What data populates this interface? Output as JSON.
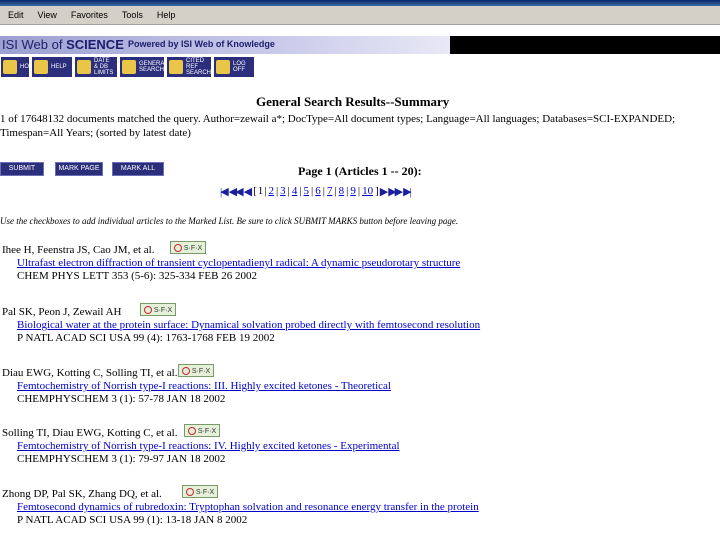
{
  "menu": [
    "Edit",
    "View",
    "Favorites",
    "Tools",
    "Help"
  ],
  "header": {
    "logo_prefix": "ISI Web of ",
    "logo_bold": "SCIENCE",
    "powered_by": "Powered by ISI Web of Knowledge"
  },
  "toolbar": [
    {
      "label": "HOME",
      "icon": "home-icon"
    },
    {
      "label": "HELP",
      "icon": "help-icon"
    },
    {
      "label": "DATE\n& DB\nLIMITS",
      "icon": "limits-icon"
    },
    {
      "label": "GENERAL\nSEARCH",
      "icon": "general-search-icon"
    },
    {
      "label": "CITED\nREF\nSEARCH",
      "icon": "cited-ref-icon"
    },
    {
      "label": "LOG\nOFF",
      "icon": "log-off-icon"
    }
  ],
  "results": {
    "heading": "General Search Results--Summary",
    "query_line1": "1 of 17648132 documents matched the query. Author=zewail a*; DocType=All document types; Language=All languages; Databases=SCI-EXPANDED;",
    "query_line2": "Timespan=All Years; (sorted by latest date)",
    "submit_marks": "SUBMIT MARKS",
    "mark_page": "MARK PAGE",
    "mark_all": "MARK ALL",
    "page_info": "Page 1 (Articles 1 -- 20):",
    "pages": [
      "1",
      "2",
      "3",
      "4",
      "5",
      "6",
      "7",
      "8",
      "9",
      "10"
    ],
    "hint": "Use the checkboxes to add individual articles to the Marked List. Be sure to click SUBMIT MARKS button before leaving page.",
    "sfx_label": "S·F·X",
    "records": [
      {
        "authors": "Ihee H, Feenstra JS, Cao JM, et al.",
        "title": "Ultrafast electron diffraction of transient cyclopentadienyl radical: A dynamic pseudorotary structure",
        "source": "CHEM PHYS LETT 353 (5-6): 325-334 FEB 26 2002"
      },
      {
        "authors": "Pal SK, Peon J, Zewail AH",
        "title": "Biological water at the protein surface: Dynamical solvation probed directly with femtosecond resolution",
        "source": "P NATL ACAD SCI USA 99 (4): 1763-1768 FEB 19 2002"
      },
      {
        "authors": "Diau EWG, Kotting C, Solling TI, et al.",
        "title": "Femtochemistry of Norrish type-I reactions: III. Highly excited ketones - Theoretical",
        "source": "CHEMPHYSCHEM 3 (1): 57-78 JAN 18 2002"
      },
      {
        "authors": "Solling TI, Diau EWG, Kotting C, et al.",
        "title": "Femtochemistry of Norrish type-I reactions: IV. Highly excited ketones - Experimental",
        "source": "CHEMPHYSCHEM 3 (1): 79-97 JAN 18 2002"
      },
      {
        "authors": "Zhong DP, Pal SK, Zhang DQ, et al.",
        "title": "Femtosecond dynamics of rubredoxin: Tryptophan solvation and resonance energy transfer in the protein",
        "source": "P NATL ACAD SCI USA 99 (1): 13-18 JAN 8 2002"
      }
    ]
  }
}
